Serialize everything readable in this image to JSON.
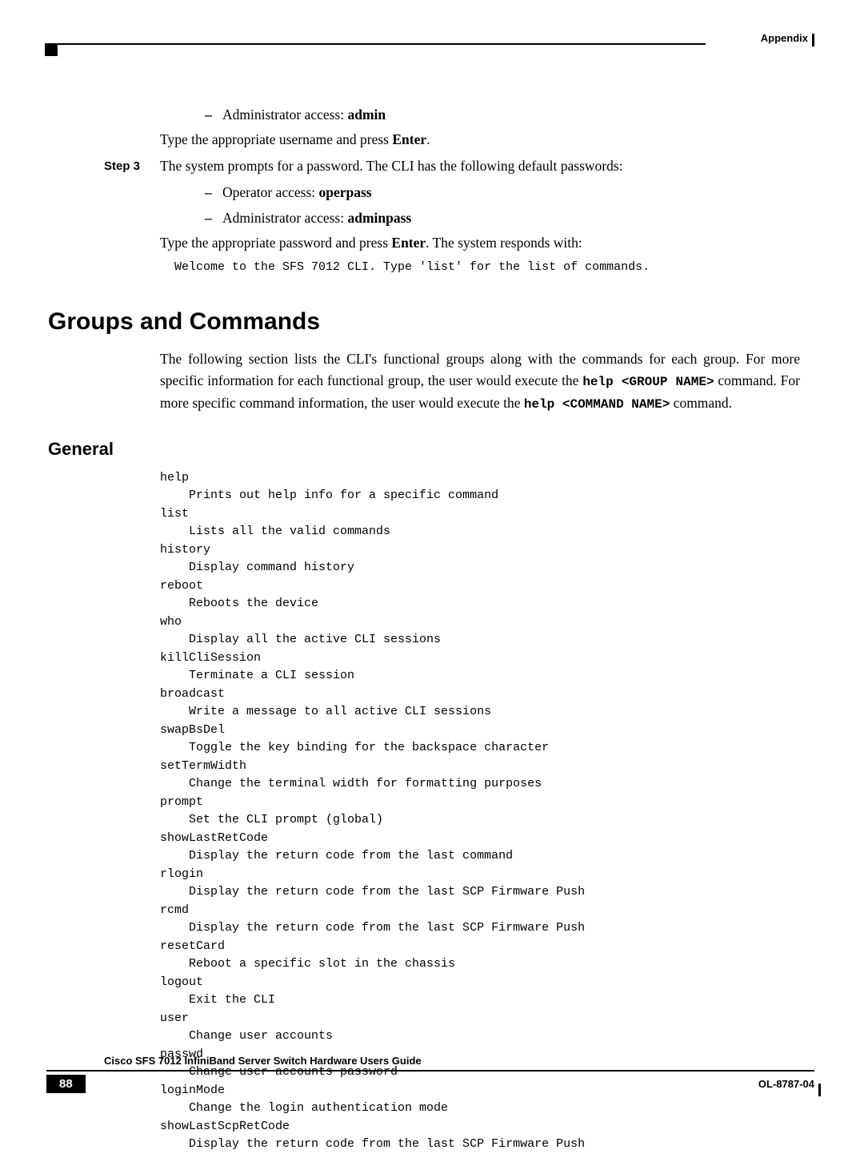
{
  "header": {
    "appendix": "Appendix"
  },
  "body": {
    "bullet1": {
      "text": "Administrator access: ",
      "bold": "admin"
    },
    "line1": {
      "pre": "Type the appropriate username and press ",
      "bold": "Enter",
      "post": "."
    },
    "step3_label": "Step 3",
    "step3_text": "The system prompts for a password. The CLI has the following default passwords:",
    "bullet2": {
      "text": "Operator access: ",
      "bold": "operpass"
    },
    "bullet3": {
      "text": "Administrator access: ",
      "bold": "adminpass"
    },
    "line2": {
      "pre": "Type the appropriate password and press ",
      "bold": "Enter",
      "post": ". The system responds with:"
    },
    "welcome_mono": "Welcome to the SFS 7012 CLI. Type 'list' for the list of commands."
  },
  "h1": "Groups and Commands",
  "para1": {
    "t1": "The following section lists the CLI's functional groups along with the commands for each group. For more specific information for each functional group, the user would execute the ",
    "c1": "help <GROUP NAME>",
    "t2": " command. For more specific command information, the user would execute the ",
    "c2": "help <COMMAND NAME>",
    "t3": " command."
  },
  "h2_general": "General",
  "general_commands": "help\n    Prints out help info for a specific command\nlist\n    Lists all the valid commands\nhistory\n    Display command history\nreboot\n    Reboots the device\nwho\n    Display all the active CLI sessions\nkillCliSession\n    Terminate a CLI session\nbroadcast\n    Write a message to all active CLI sessions\nswapBsDel\n    Toggle the key binding for the backspace character\nsetTermWidth\n    Change the terminal width for formatting purposes\nprompt\n    Set the CLI prompt (global)\nshowLastRetCode\n    Display the return code from the last command\nrlogin\n    Display the return code from the last SCP Firmware Push\nrcmd\n    Display the return code from the last SCP Firmware Push\nresetCard\n    Reboot a specific slot in the chassis\nlogout\n    Exit the CLI\nuser\n    Change user accounts\npasswd\n    Change user accounts password\nloginMode\n    Change the login authentication mode\nshowLastScpRetCode\n    Display the return code from the last SCP Firmware Push",
  "footer": {
    "title": "Cisco SFS 7012 InfiniBand Server Switch Hardware Users Guide",
    "page": "88",
    "docid": "OL-8787-04"
  }
}
